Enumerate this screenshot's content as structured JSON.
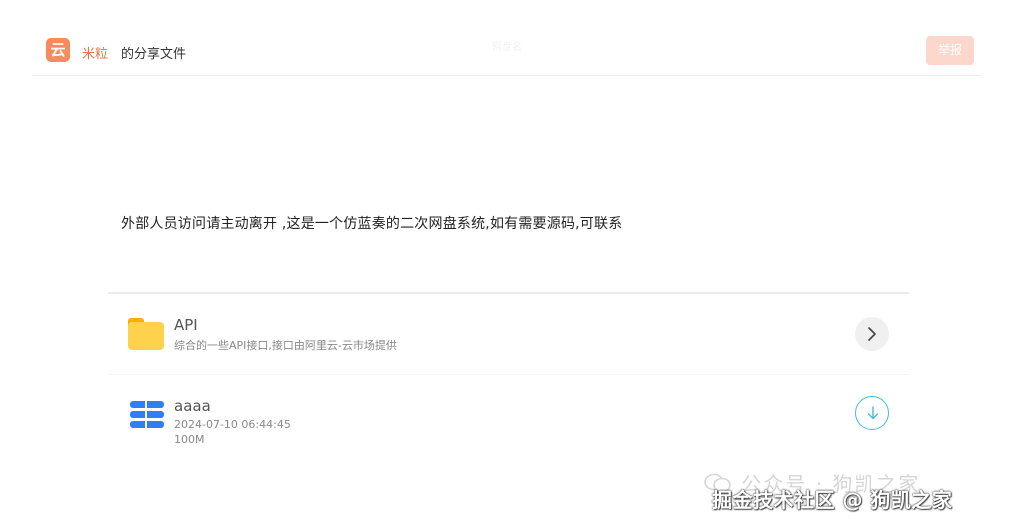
{
  "header": {
    "logo_glyph": "云",
    "owner_name": "米粒",
    "share_suffix": "的分享文件",
    "center_faint_text": "网盘名",
    "report_label": "举报"
  },
  "description": "外部人员访问请主动离开 ,这是一个仿蓝奏的二次网盘系统,如有需要源码,可联系",
  "files": [
    {
      "name": "API",
      "subtitle": "综合的一些API接口,接口由阿里云-云市场提供",
      "icon": "folder-icon",
      "action_icon": "chevron-right-icon"
    },
    {
      "name": "aaaa",
      "date": "2024-07-10 06:44:45",
      "size": "100M",
      "icon": "database-icon",
      "action_icon": "download-icon"
    }
  ],
  "watermark": {
    "line1": "公众号 · 狗凯之家",
    "line2": "掘金技术社区 @ 狗凯之家"
  },
  "colors": {
    "brand_orange": "#f78b5c",
    "owner_text": "#e8704a",
    "report_button": "#fdd7cc",
    "folder_yellow": "#ffd24d",
    "db_blue": "#2f7ef5",
    "download_teal": "#4ab8d8"
  }
}
